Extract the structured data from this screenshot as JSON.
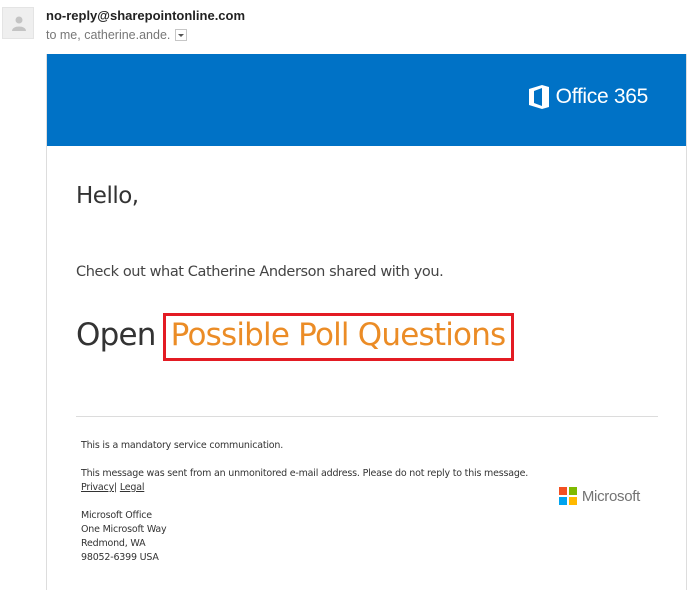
{
  "email_header": {
    "sender": "no-reply@sharepointonline.com",
    "recipients": "to me, catherine.ande.",
    "avatar_icon": "person-icon",
    "details_icon": "chevron-down-icon"
  },
  "banner": {
    "brand_icon": "office-logo-icon",
    "brand_text": "Office 365",
    "color": "#0072c6"
  },
  "body": {
    "greeting": "Hello,",
    "message": "Check out what Catherine Anderson shared with you.",
    "open_prefix": "Open",
    "document_link": "Possible Poll Questions",
    "link_color": "#eb8c26",
    "highlight_color": "#e31b23"
  },
  "footer": {
    "notice": "This is a mandatory service communication.",
    "unmonitored": "This message was sent from an unmonitored e-mail address. Please do not reply to this message.",
    "privacy_link": "Privacy",
    "separator": "|",
    "legal_link": "Legal",
    "address": [
      "Microsoft Office",
      "One Microsoft Way",
      "Redmond, WA",
      "98052-6399 USA"
    ],
    "ms_logo_text": "Microsoft",
    "ms_logo_colors": [
      "#f25022",
      "#7fba00",
      "#00a4ef",
      "#ffb900"
    ]
  }
}
